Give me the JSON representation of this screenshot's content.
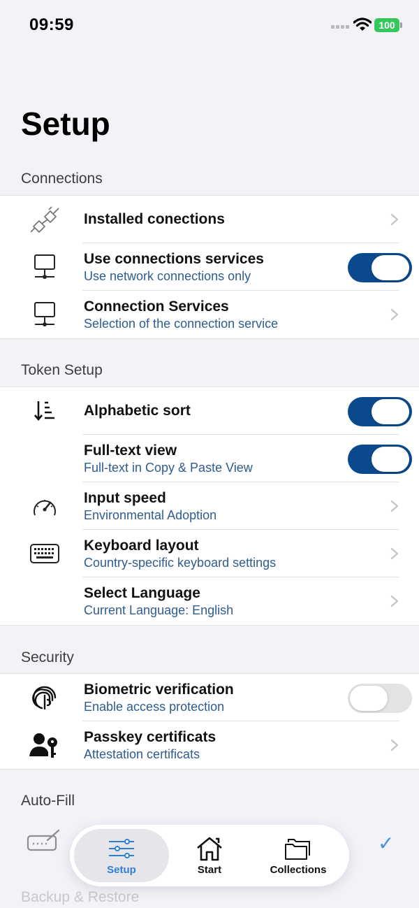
{
  "status": {
    "time": "09:59",
    "battery": "100"
  },
  "page": {
    "title": "Setup"
  },
  "sections": {
    "connections": {
      "header": "Connections",
      "items": [
        {
          "title": "Installed conections",
          "icon": "plug-icon"
        },
        {
          "title": "Use connections services",
          "subtitle": "Use network connections only",
          "icon": "network-icon",
          "toggle": true
        },
        {
          "title": "Connection Services",
          "subtitle": "Selection of the connection service",
          "icon": "network-icon"
        }
      ]
    },
    "token": {
      "header": "Token Setup",
      "items": [
        {
          "title": "Alphabetic sort",
          "icon": "sort-icon",
          "toggle": true
        },
        {
          "title": "Full-text view",
          "subtitle": "Full-text in Copy & Paste View",
          "toggle": true
        },
        {
          "title": "Input speed",
          "subtitle": "Environmental Adoption",
          "icon": "speedometer-icon"
        },
        {
          "title": "Keyboard layout",
          "subtitle": "Country-specific keyboard settings",
          "icon": "keyboard-icon"
        },
        {
          "title": "Select Language",
          "subtitle": "Current Language: English"
        }
      ]
    },
    "security": {
      "header": "Security",
      "items": [
        {
          "title": "Biometric verification",
          "subtitle": "Enable access protection",
          "icon": "fingerprint-icon",
          "toggle": false
        },
        {
          "title": "Passkey certificats",
          "subtitle": "Attestation certificats",
          "icon": "user-key-icon"
        }
      ]
    },
    "autofill": {
      "header": "Auto-Fill"
    },
    "backup": {
      "header": "Backup & Restore"
    }
  },
  "tabbar": {
    "tabs": [
      {
        "label": "Setup",
        "icon": "sliders-icon",
        "active": true
      },
      {
        "label": "Start",
        "icon": "home-icon"
      },
      {
        "label": "Collections",
        "icon": "folders-icon"
      }
    ]
  },
  "colors": {
    "accent": "#0a4a8c",
    "subtitle": "#2f5c8f",
    "tab_active": "#2f7fd6",
    "battery": "#34c759"
  }
}
